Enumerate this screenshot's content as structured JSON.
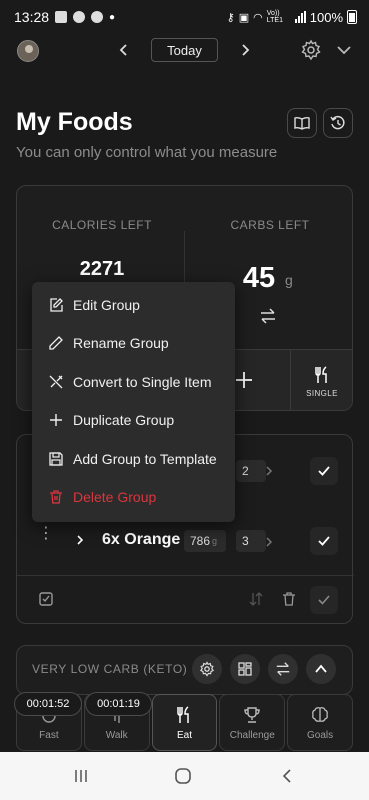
{
  "status_bar": {
    "time": "13:28",
    "battery": "100%",
    "network": "Vo)) LTE1"
  },
  "top_nav": {
    "date_label": "Today"
  },
  "page": {
    "title": "My Foods",
    "subtitle": "You can only control what you measure"
  },
  "stats": {
    "calories_label": "CALORIES LEFT",
    "calories_value": "2271",
    "carbs_label": "CARBS LEFT",
    "carbs_value": "45",
    "carbs_unit": "g",
    "single_label": "SINGLE"
  },
  "group": {
    "rows": [
      {
        "name": "",
        "qty": "2"
      },
      {
        "name": "6x Orange",
        "grams": "786",
        "grams_unit": "g",
        "qty": "3"
      }
    ]
  },
  "plan": {
    "label": "VERY LOW CARB (KETO)"
  },
  "context_menu": {
    "items": [
      {
        "label": "Edit Group",
        "icon": "edit-icon"
      },
      {
        "label": "Rename Group",
        "icon": "pencil-icon"
      },
      {
        "label": "Convert to Single Item",
        "icon": "utensils-crossed-icon"
      },
      {
        "label": "Duplicate Group",
        "icon": "plus-icon"
      },
      {
        "label": "Add Group to Template",
        "icon": "save-icon"
      },
      {
        "label": "Delete Group",
        "icon": "trash-icon",
        "color": "#d9363e"
      }
    ]
  },
  "timers": {
    "fast": "00:01:52",
    "walk": "00:01:19"
  },
  "bottom_nav": [
    {
      "label": "Fast",
      "icon": "fast-icon"
    },
    {
      "label": "Walk",
      "icon": "walk-icon"
    },
    {
      "label": "Eat",
      "icon": "utensils-icon",
      "active": true
    },
    {
      "label": "Challenge",
      "icon": "trophy-icon"
    },
    {
      "label": "Goals",
      "icon": "brain-icon"
    }
  ],
  "colors": {
    "background": "#1a1a1a",
    "danger": "#d9363e",
    "text": "#f2f2f2",
    "muted": "#8a8a8a"
  }
}
